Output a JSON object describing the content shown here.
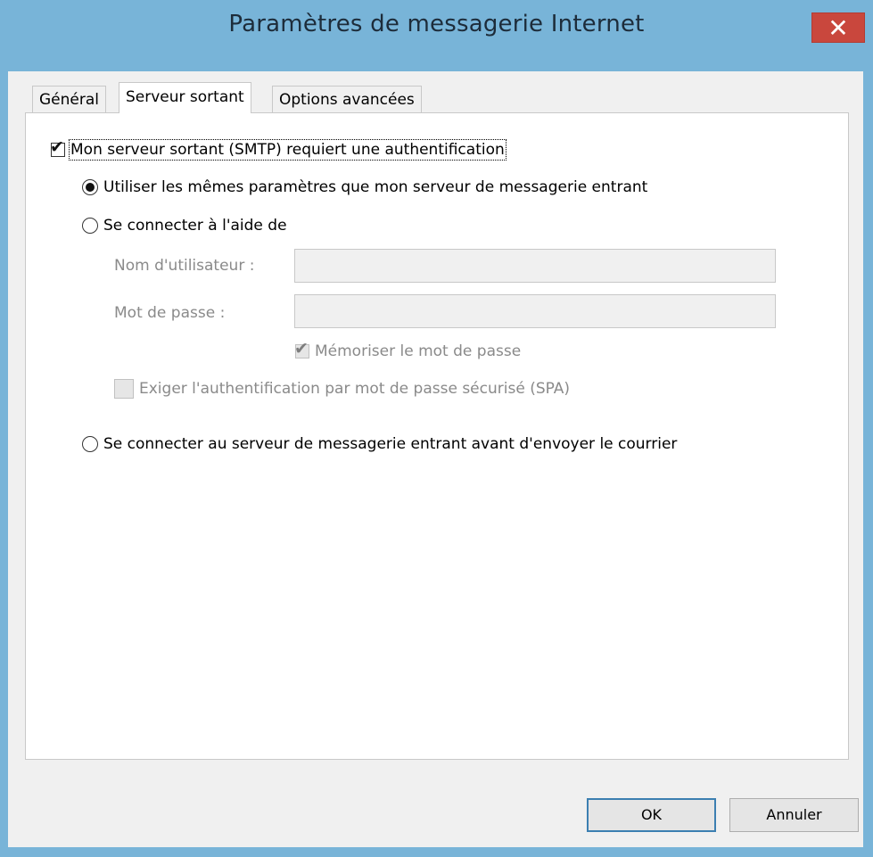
{
  "window": {
    "title": "Paramètres de messagerie Internet",
    "close_glyph": "✕"
  },
  "tabs": [
    {
      "label": "Général",
      "active": false
    },
    {
      "label": "Serveur sortant",
      "active": true
    },
    {
      "label": "Options avancées",
      "active": false
    }
  ],
  "smtp_auth": {
    "label": "Mon serveur sortant (SMTP) requiert une authentification",
    "checked": true
  },
  "options": {
    "same_settings": {
      "label": "Utiliser les mêmes paramètres que mon serveur de messagerie entrant",
      "selected": true
    },
    "connect_with": {
      "label": "Se connecter à l'aide de",
      "selected": false
    },
    "connect_incoming_first": {
      "label": "Se connecter au serveur de messagerie entrant avant d'envoyer le courrier",
      "selected": false
    }
  },
  "credentials": {
    "username_label": "Nom d'utilisateur :",
    "username_value": "",
    "password_label": "Mot de passe :",
    "password_value": "",
    "remember_password": {
      "label": "Mémoriser le mot de passe",
      "checked": true,
      "disabled": true
    },
    "require_spa": {
      "label": "Exiger l'authentification par mot de passe sécurisé (SPA)",
      "checked": false,
      "disabled": true
    }
  },
  "buttons": {
    "ok": "OK",
    "cancel": "Annuler"
  },
  "colors": {
    "frame": "#78b4d8",
    "close": "#c9473d",
    "dialog_bg": "#f0f0f0",
    "default_button_border": "#3c7fb1"
  }
}
